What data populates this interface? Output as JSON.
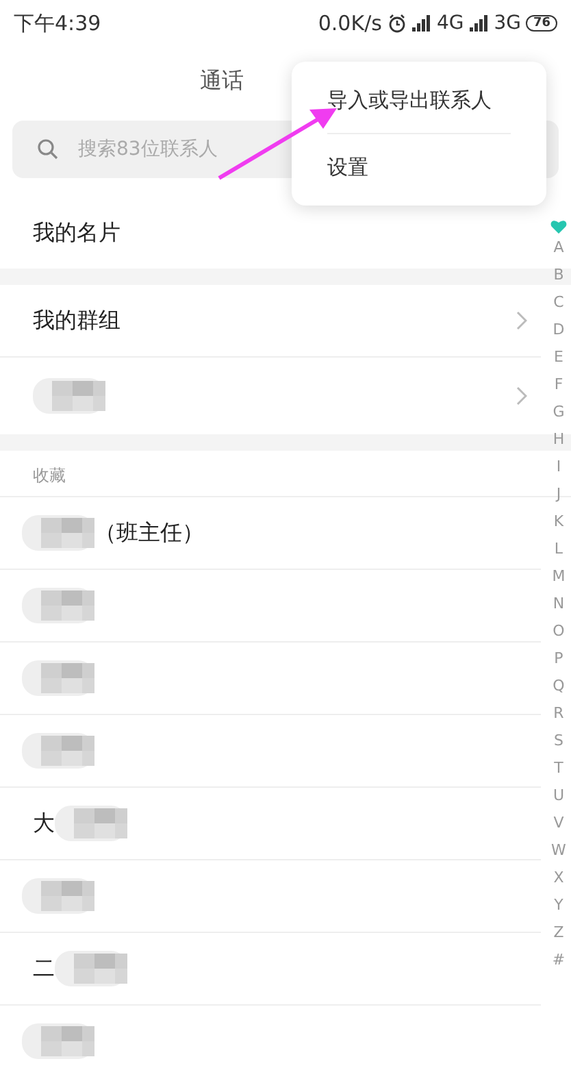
{
  "status_bar": {
    "time": "下午4:39",
    "speed": "0.0K/s",
    "network_1": "4G",
    "network_2": "3G",
    "battery": "76"
  },
  "header": {
    "title": "通话"
  },
  "search": {
    "placeholder": "搜索83位联系人"
  },
  "menu": {
    "items": [
      {
        "label": "导入或导出联系人"
      },
      {
        "label": "设置"
      }
    ]
  },
  "my_card": {
    "label": "我的名片"
  },
  "groups": [
    {
      "parts": [
        {
          "kind": "text",
          "text": "我的群组"
        }
      ]
    },
    {
      "parts": [
        {
          "kind": "mosaic"
        }
      ]
    }
  ],
  "favorites": {
    "heading": "收藏",
    "contacts": [
      {
        "parts": [
          {
            "kind": "mosaic"
          },
          {
            "kind": "text",
            "text": "（班主任）"
          }
        ]
      },
      {
        "parts": [
          {
            "kind": "mosaic"
          }
        ]
      },
      {
        "parts": [
          {
            "kind": "mosaic"
          }
        ]
      },
      {
        "parts": [
          {
            "kind": "mosaic"
          }
        ]
      },
      {
        "parts": [
          {
            "kind": "text",
            "text": "大"
          },
          {
            "kind": "mosaic"
          }
        ]
      },
      {
        "parts": [
          {
            "kind": "mosaic"
          }
        ]
      },
      {
        "parts": [
          {
            "kind": "text",
            "text": "二"
          },
          {
            "kind": "mosaic"
          }
        ]
      },
      {
        "parts": [
          {
            "kind": "mosaic"
          }
        ]
      }
    ]
  },
  "index": [
    "A",
    "B",
    "C",
    "D",
    "E",
    "F",
    "G",
    "H",
    "I",
    "J",
    "K",
    "L",
    "M",
    "N",
    "O",
    "P",
    "Q",
    "R",
    "S",
    "T",
    "U",
    "V",
    "W",
    "X",
    "Y",
    "Z",
    "#"
  ]
}
